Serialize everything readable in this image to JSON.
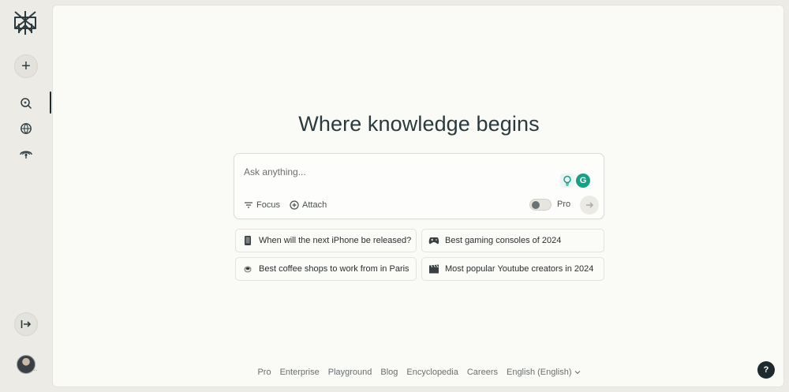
{
  "sidebar": {
    "new_thread_label": "+",
    "nav": [
      {
        "name": "discover",
        "icon": "search-icon"
      },
      {
        "name": "spaces",
        "icon": "globe-icon"
      },
      {
        "name": "library",
        "icon": "library-icon"
      }
    ],
    "collapse_icon": "collapse-icon"
  },
  "main": {
    "headline": "Where knowledge begins",
    "search": {
      "placeholder": "Ask anything...",
      "focus_label": "Focus",
      "attach_label": "Attach",
      "pro_label": "Pro",
      "pro_enabled": false
    },
    "suggestions": [
      {
        "label": "When will the next iPhone be released?",
        "icon": "phone-icon"
      },
      {
        "label": "Best gaming consoles of 2024",
        "icon": "gamepad-icon"
      },
      {
        "label": "Best coffee shops to work from in Paris",
        "icon": "coffee-icon"
      },
      {
        "label": "Most popular Youtube creators in 2024",
        "icon": "clapperboard-icon"
      }
    ]
  },
  "footer": {
    "links": [
      "Pro",
      "Enterprise",
      "Playground",
      "Blog",
      "Encyclopedia",
      "Careers",
      "English (English)"
    ]
  },
  "help_label": "?",
  "colors": {
    "background": "#ecebe6",
    "panel": "#fafaf7",
    "text_dark": "#1f2a2e",
    "grammarly_green": "#16a085"
  }
}
